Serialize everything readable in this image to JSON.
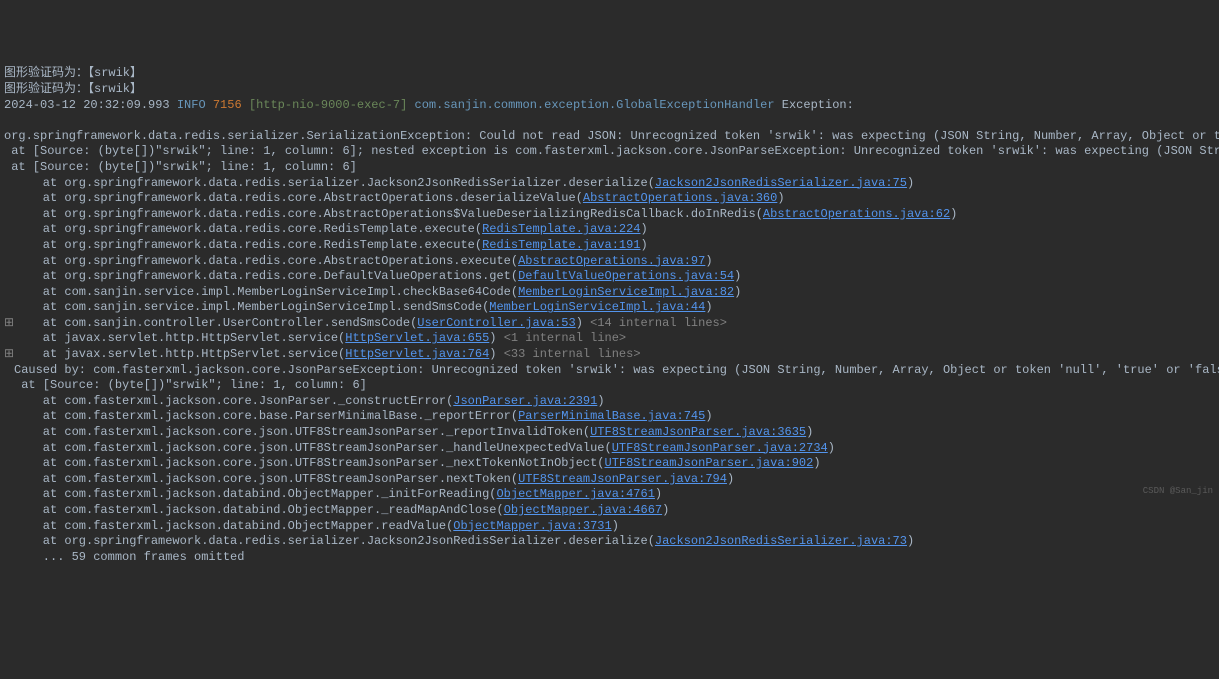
{
  "header": {
    "line1_prefix": "图形验证码为：【",
    "line1_code": "srwik",
    "line1_suffix": "】",
    "line2_prefix": "图形验证码为：【",
    "line2_code": "srwik",
    "line2_suffix": "】",
    "timestamp": "2024-03-12 20:32:09.993",
    "level": "INFO",
    "thread_id": "7156",
    "thread_name": "[http-nio-9000-exec-7]",
    "class_name": "com.sanjin.common.exception.GlobalExceptionHandler",
    "exception_label": " Exception:"
  },
  "exception": {
    "message": "org.springframework.data.redis.serializer.SerializationException: Could not read JSON: Unrecognized token 'srwik': was expecting (JSON String, Number, Array, Object or token 'null', 'true' or 'false')",
    "source1": " at [Source: (byte[])\"srwik\"; line: 1, column: 6]; nested exception is com.fasterxml.jackson.core.JsonParseException: Unrecognized token 'srwik': was expecting (JSON String, Number, Array, Object or token 'null', 'true' or '",
    "source2": " at [Source: (byte[])\"srwik\"; line: 1, column: 6]"
  },
  "stack1": [
    {
      "prefix": "    at org.springframework.data.redis.serializer.Jackson2JsonRedisSerializer.deserialize(",
      "link": "Jackson2JsonRedisSerializer.java:75",
      "suffix": ")"
    },
    {
      "prefix": "    at org.springframework.data.redis.core.AbstractOperations.deserializeValue(",
      "link": "AbstractOperations.java:360",
      "suffix": ")"
    },
    {
      "prefix": "    at org.springframework.data.redis.core.AbstractOperations$ValueDeserializingRedisCallback.doInRedis(",
      "link": "AbstractOperations.java:62",
      "suffix": ")"
    },
    {
      "prefix": "    at org.springframework.data.redis.core.RedisTemplate.execute(",
      "link": "RedisTemplate.java:224",
      "suffix": ")"
    },
    {
      "prefix": "    at org.springframework.data.redis.core.RedisTemplate.execute(",
      "link": "RedisTemplate.java:191",
      "suffix": ")"
    },
    {
      "prefix": "    at org.springframework.data.redis.core.AbstractOperations.execute(",
      "link": "AbstractOperations.java:97",
      "suffix": ")"
    },
    {
      "prefix": "    at org.springframework.data.redis.core.DefaultValueOperations.get(",
      "link": "DefaultValueOperations.java:54",
      "suffix": ")"
    },
    {
      "prefix": "    at com.sanjin.service.impl.MemberLoginServiceImpl.checkBase64Code(",
      "link": "MemberLoginServiceImpl.java:82",
      "suffix": ")"
    },
    {
      "prefix": "    at com.sanjin.service.impl.MemberLoginServiceImpl.sendSmsCode(",
      "link": "MemberLoginServiceImpl.java:44",
      "suffix": ")"
    },
    {
      "prefix": "    at com.sanjin.controller.UserController.sendSmsCode(",
      "link": "UserController.java:53",
      "suffix": ") ",
      "internal": "<14 internal lines>",
      "gutter": "⊞"
    },
    {
      "prefix": "    at javax.servlet.http.HttpServlet.service(",
      "link": "HttpServlet.java:655",
      "suffix": ") ",
      "internal": "<1 internal line>"
    },
    {
      "prefix": "    at javax.servlet.http.HttpServlet.service(",
      "link": "HttpServlet.java:764",
      "suffix": ") ",
      "internal": "<33 internal lines>",
      "gutter": "⊞"
    }
  ],
  "caused_by": {
    "message": "Caused by: com.fasterxml.jackson.core.JsonParseException: Unrecognized token 'srwik': was expecting (JSON String, Number, Array, Object or token 'null', 'true' or 'false')",
    "source": " at [Source: (byte[])\"srwik\"; line: 1, column: 6]"
  },
  "stack2": [
    {
      "prefix": "    at com.fasterxml.jackson.core.JsonParser._constructError(",
      "link": "JsonParser.java:2391",
      "suffix": ")"
    },
    {
      "prefix": "    at com.fasterxml.jackson.core.base.ParserMinimalBase._reportError(",
      "link": "ParserMinimalBase.java:745",
      "suffix": ")"
    },
    {
      "prefix": "    at com.fasterxml.jackson.core.json.UTF8StreamJsonParser._reportInvalidToken(",
      "link": "UTF8StreamJsonParser.java:3635",
      "suffix": ")"
    },
    {
      "prefix": "    at com.fasterxml.jackson.core.json.UTF8StreamJsonParser._handleUnexpectedValue(",
      "link": "UTF8StreamJsonParser.java:2734",
      "suffix": ")"
    },
    {
      "prefix": "    at com.fasterxml.jackson.core.json.UTF8StreamJsonParser._nextTokenNotInObject(",
      "link": "UTF8StreamJsonParser.java:902",
      "suffix": ")"
    },
    {
      "prefix": "    at com.fasterxml.jackson.core.json.UTF8StreamJsonParser.nextToken(",
      "link": "UTF8StreamJsonParser.java:794",
      "suffix": ")"
    },
    {
      "prefix": "    at com.fasterxml.jackson.databind.ObjectMapper._initForReading(",
      "link": "ObjectMapper.java:4761",
      "suffix": ")"
    },
    {
      "prefix": "    at com.fasterxml.jackson.databind.ObjectMapper._readMapAndClose(",
      "link": "ObjectMapper.java:4667",
      "suffix": ")"
    },
    {
      "prefix": "    at com.fasterxml.jackson.databind.ObjectMapper.readValue(",
      "link": "ObjectMapper.java:3731",
      "suffix": ")"
    },
    {
      "prefix": "    at org.springframework.data.redis.serializer.Jackson2JsonRedisSerializer.deserialize(",
      "link": "Jackson2JsonRedisSerializer.java:73",
      "suffix": ")"
    }
  ],
  "omitted": "    ... 59 common frames omitted",
  "watermark": "CSDN @San_jin"
}
